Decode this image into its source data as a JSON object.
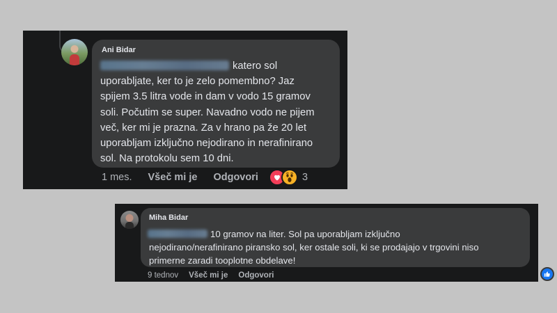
{
  "comments": [
    {
      "author": "Ani Bidar",
      "text": "katero sol\nuporabljate, ker to je zelo pomembno? Jaz\nspijem 3.5 litra vode in dam v vodo 15 gramov\nsoli. Počutim se super. Navadno vodo ne pijem\nveč, ker mi je prazna. Za v hrano pa že 20 let\nuporabljam izključno nejodirano in nerafinirano\nsol.  Na protokolu sem 10 dni.",
      "time": "1 mes.",
      "like_label": "Všeč mi je",
      "reply_label": "Odgovori",
      "reaction_count": "3",
      "reactions": [
        "heart-icon",
        "wow-icon"
      ]
    },
    {
      "author": "Miha Bidar",
      "text": "10 gramov na liter. Sol pa uporabljam izključno\nnejodirano/nerafinirano piransko sol, ker ostale soli, ki se prodajajo v trgovini niso\nprimerne zaradi tooplotne obdelave!",
      "time": "9 tednov",
      "like_label": "Všeč mi je",
      "reply_label": "Odgovori",
      "reactions": [
        "like-icon"
      ]
    }
  ],
  "colors": {
    "background": "#c4c4c4",
    "panel": "#18191a",
    "bubble": "#3a3b3c",
    "text": "#e4e6eb",
    "secondary_text": "#b0b3b8",
    "love": "#f33e58",
    "wow": "#f7b125",
    "like": "#1877f2"
  }
}
